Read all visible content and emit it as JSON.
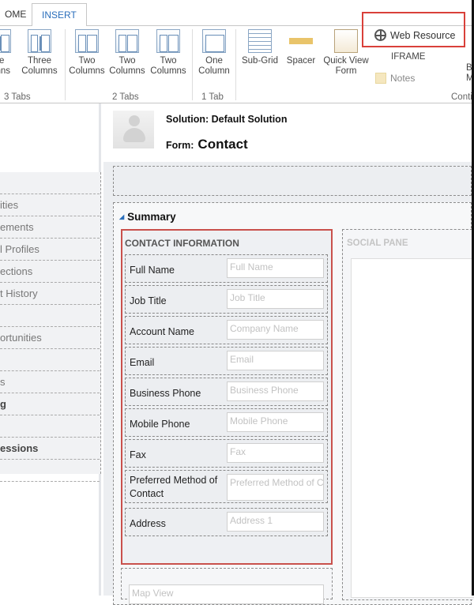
{
  "tabs": {
    "home": "OME",
    "insert": "INSERT"
  },
  "ribbon": {
    "buttons": [
      {
        "l1": "ee",
        "l2": "umns",
        "icon": "three-columns"
      },
      {
        "l1": "Three",
        "l2": "Columns",
        "icon": "three-columns"
      },
      {
        "l1": "Two",
        "l2": "Columns",
        "icon": "two-columns"
      },
      {
        "l1": "Two",
        "l2": "Columns",
        "icon": "two-columns"
      },
      {
        "l1": "Two",
        "l2": "Columns",
        "icon": "two-columns"
      },
      {
        "l1": "One",
        "l2": "Column",
        "icon": "one-column"
      },
      {
        "l1": "Sub-Grid",
        "l2": "",
        "icon": "subgrid"
      },
      {
        "l1": "Spacer",
        "l2": "",
        "icon": "spacer"
      },
      {
        "l1": "Quick View",
        "l2": "Form",
        "icon": "quick-view-form"
      }
    ],
    "groups": [
      "3 Tabs",
      "2 Tabs",
      "1 Tab",
      "Conti"
    ],
    "web_resource": "Web Resource",
    "iframe": "IFRAME",
    "notes": "Notes",
    "partial": "B\nM",
    "highlight_color": "#d9403a"
  },
  "sidebar": {
    "items": [
      "",
      "ities",
      "ements",
      "l Profiles",
      "ections",
      "t History",
      "",
      "ortunities",
      "",
      "s",
      "g",
      "",
      "essions",
      ""
    ]
  },
  "header": {
    "solution": "Solution: Default Solution",
    "form_label": "Form:",
    "form_name": "Contact"
  },
  "section": {
    "title": "Summary",
    "contact_header": "CONTACT INFORMATION",
    "social_pane": "SOCIAL PANE",
    "map_placeholder": "Map View"
  },
  "fields": [
    {
      "label": "Full Name",
      "placeholder": "Full Name"
    },
    {
      "label": "Job Title",
      "placeholder": "Job Title"
    },
    {
      "label": "Account Name",
      "placeholder": "Company Name"
    },
    {
      "label": "Email",
      "placeholder": "Email"
    },
    {
      "label": "Business Phone",
      "placeholder": "Business Phone"
    },
    {
      "label": "Mobile Phone",
      "placeholder": "Mobile Phone"
    },
    {
      "label": "Fax",
      "placeholder": "Fax"
    },
    {
      "label": "Preferred Method of Contact",
      "placeholder": "Preferred Method of C"
    },
    {
      "label": "Address",
      "placeholder": "Address 1"
    }
  ]
}
